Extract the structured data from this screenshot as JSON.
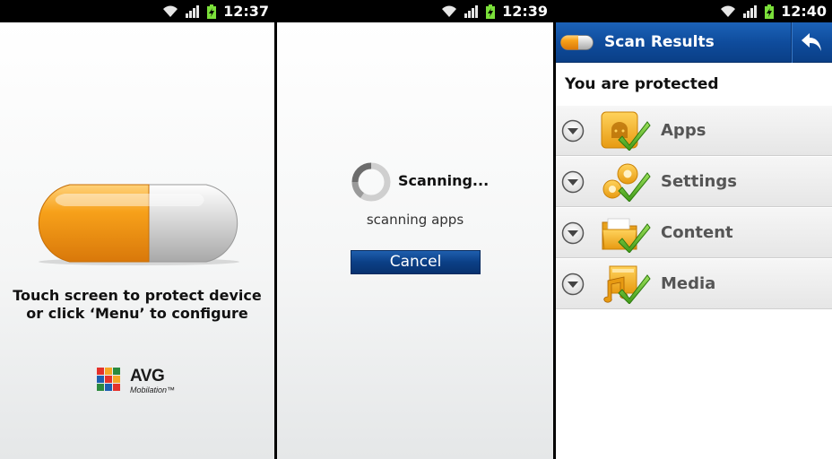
{
  "panel1": {
    "status": {
      "time": "12:37"
    },
    "prompt_line1": "Touch screen to protect device",
    "prompt_line2": "or click ‘Menu’ to configure",
    "logo": {
      "brand": "AVG",
      "product": "Mobilation™"
    }
  },
  "panel2": {
    "status": {
      "time": "12:39"
    },
    "scanning_title": "Scanning...",
    "scanning_subtitle": "scanning apps",
    "cancel_label": "Cancel"
  },
  "panel3": {
    "status": {
      "time": "12:40"
    },
    "header": {
      "title": "Scan Results",
      "back_icon": "back-arrow-icon"
    },
    "protected_text": "You are protected",
    "categories": [
      {
        "label": "Apps",
        "icon": "apps-check-icon"
      },
      {
        "label": "Settings",
        "icon": "settings-check-icon"
      },
      {
        "label": "Content",
        "icon": "folder-check-icon"
      },
      {
        "label": "Media",
        "icon": "media-check-icon"
      }
    ]
  },
  "colors": {
    "header_blue": "#0f4c9d",
    "button_blue": "#0b3f86",
    "pill_orange": "#f39a12",
    "check_green": "#5cb82a"
  }
}
